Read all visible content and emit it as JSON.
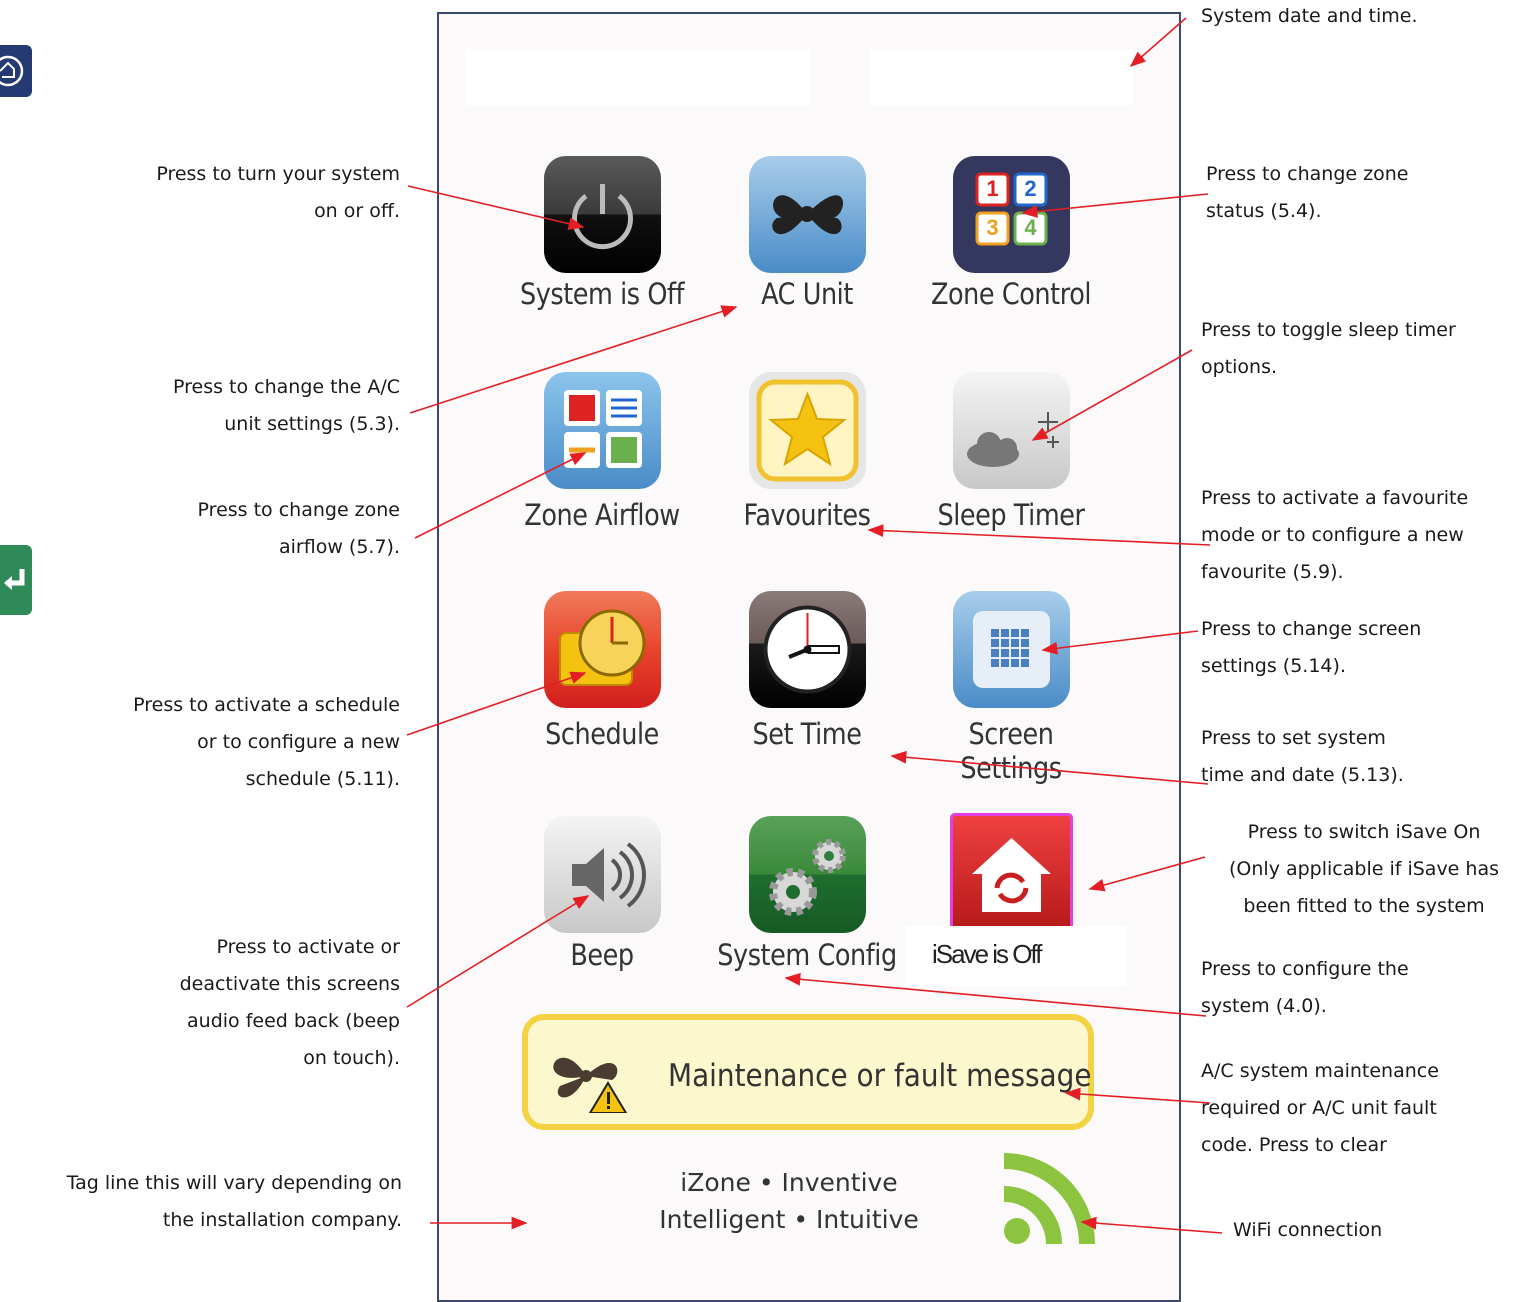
{
  "annotations": {
    "date_time": "System date and  time.",
    "power": "Press to turn your system\non or off.",
    "zone_status": "Press to change zone\nstatus (5.4).",
    "ac_unit": "Press to change the A/C\nunit settings (5.3).",
    "sleep": "Press to toggle sleep timer\noptions.",
    "airflow": "Press to change zone\nairflow (5.7).",
    "favourite": "Press to activate a favourite\nmode or to configure a new\nfavourite (5.9).",
    "screen": "Press to change screen\nsettings (5.14).",
    "schedule": "Press to activate a schedule\nor to configure a new\nschedule (5.11).",
    "set_time": "Press to set system\ntime and date (5.13).",
    "isave": "Press to switch iSave On\n(Only applicable if iSave has\nbeen fitted to the system",
    "beep": "Press to activate or\ndeactivate this  screens\naudio feed back (beep\non touch).",
    "config": "Press to configure the\nsystem (4.0).",
    "maintenance": "A/C system maintenance\nrequired or A/C unit fault\ncode. Press to clear",
    "tagline": "Tag line  this will vary depending on\nthe installation company.",
    "wifi": "WiFi connection"
  },
  "tiles": {
    "power": "System is Off",
    "ac_unit": "AC Unit",
    "zone_control": "Zone Control",
    "zone_airflow": "Zone Airflow",
    "favourites": "Favourites",
    "sleep_timer": "Sleep Timer",
    "schedule": "Schedule",
    "set_time": "Set Time",
    "screen_settings": "Screen Settings",
    "beep": "Beep",
    "system_config": "System Config",
    "isave": "iSave is Off"
  },
  "zone_numbers": [
    "1",
    "2",
    "3",
    "4"
  ],
  "maintenance_message": "Maintenance or fault message",
  "tagline": "iZone • Inventive\nIntelligent • Intuitive",
  "colors": {
    "arrow": "#e31e24",
    "device_border": "#3b4a6b",
    "maint_border": "#f3d343",
    "wifi": "#8cc43f"
  }
}
